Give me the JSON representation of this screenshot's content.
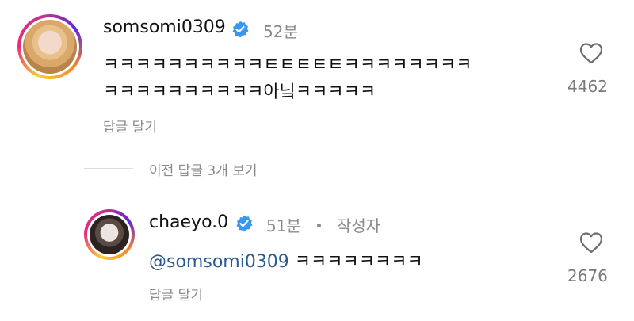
{
  "comment": {
    "username": "somsomi0309",
    "time": "52분",
    "text_line1": "ㅋㅋㅋㅋㅋㅋㅋㅋㅋㅋㅌㅌㅌㅌㅌㅋㅋㅋㅋㅋㅋㅋㅋ",
    "text_line2": "ㅋㅋㅋㅋㅋㅋㅋㅋㅋㅋ아닠ㅋㅋㅋㅋㅋ",
    "reply_label": "답글 달기",
    "like_count": "4462"
  },
  "view_prev_replies": "이전 답글 3개 보기",
  "reply": {
    "username": "chaeyo.0",
    "time": "51분",
    "author_badge": "작성자",
    "mention": "@somsomi0309",
    "text": " ㅋㅋㅋㅋㅋㅋㅋㅋ",
    "reply_label": "답글 달기",
    "like_count": "2676"
  },
  "colors": {
    "verified": "#3897f0",
    "mention": "#2a5a8e"
  },
  "icons": [
    "verified-badge-icon",
    "heart-icon"
  ]
}
